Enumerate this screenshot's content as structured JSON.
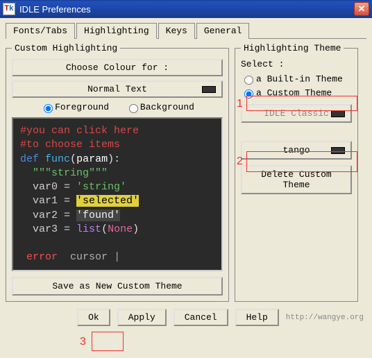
{
  "window": {
    "title": "IDLE Preferences"
  },
  "tabs": {
    "fonts": "Fonts/Tabs",
    "highlighting": "Highlighting",
    "keys": "Keys",
    "general": "General"
  },
  "left": {
    "legend": "Custom Highlighting",
    "choose_colour": "Choose Colour for :",
    "normal_text": "Normal Text",
    "fg": "Foreground",
    "bg": "Background",
    "save": "Save as New Custom Theme"
  },
  "code": {
    "c1": "#you can click here",
    "c2": "#to choose items",
    "kw_def": "def",
    "func": "func",
    "param": "param",
    "triple": "\"\"\"string\"\"\"",
    "var0": "var0",
    "var1": "var1",
    "var2": "var2",
    "var3": "var3",
    "eq": " = ",
    "str0": "'string'",
    "sel": "'selected'",
    "found": "'found'",
    "list": "list",
    "none": "None",
    "error": "error",
    "cursor": "cursor",
    "pipe": "|"
  },
  "right": {
    "legend": "Highlighting Theme",
    "select": "Select :",
    "builtin": "a Built-in Theme",
    "custom": "a Custom Theme",
    "combo_builtin": "IDLE Classic",
    "combo_custom": "tango",
    "delete": "Delete Custom Theme"
  },
  "buttons": {
    "ok": "Ok",
    "apply": "Apply",
    "cancel": "Cancel",
    "help": "Help"
  },
  "footer": "http://wangye.org",
  "callouts": {
    "n1": "1",
    "n2": "2",
    "n3": "3"
  }
}
